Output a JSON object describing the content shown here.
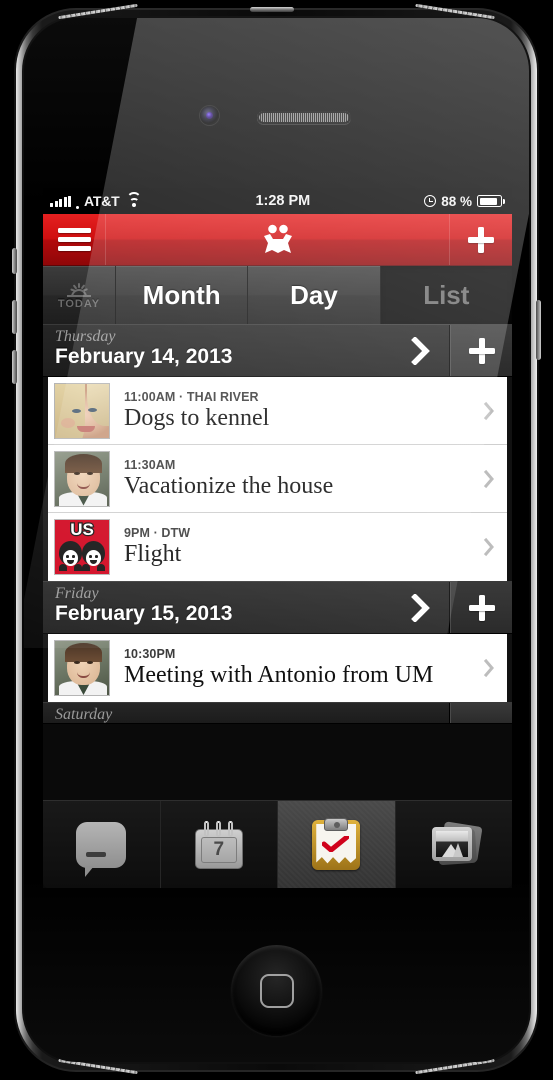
{
  "status_bar": {
    "signal_icon": "signal-bars-icon",
    "carrier": "AT&T",
    "wifi_icon": "wifi-icon",
    "time": "1:28 PM",
    "alarm_icon": "clock-icon",
    "battery_percent": "88 %",
    "battery_icon": "battery-icon"
  },
  "nav_bar": {
    "menu_icon": "hamburger-menu-icon",
    "logo_icon": "cozi-family-logo-icon",
    "add_icon": "plus-icon",
    "accent_color": "#cf0f10"
  },
  "tabs": [
    {
      "label": "TODAY",
      "icon": "sunrise-icon",
      "selected": false
    },
    {
      "label": "Month",
      "icon": "",
      "selected": false
    },
    {
      "label": "Day",
      "icon": "",
      "selected": false
    },
    {
      "label": "List",
      "icon": "",
      "selected": true
    }
  ],
  "agenda": {
    "days": [
      {
        "weekday": "Thursday",
        "date": "February 14, 2013",
        "chevron_icon": "chevron-right-icon",
        "add_icon": "plus-icon",
        "events": [
          {
            "meta": "11:00AM · THAI RIVER",
            "title": "Dogs to kennel",
            "avatar": "photo-woman",
            "chevron_icon": "chevron-right-icon"
          },
          {
            "meta": "11:30AM",
            "title": "Vacationize the house",
            "avatar": "photo-man",
            "chevron_icon": "chevron-right-icon"
          },
          {
            "meta": "9PM · DTW",
            "title": "Flight",
            "avatar": "us-family-badge",
            "avatar_label": "US",
            "chevron_icon": "chevron-right-icon"
          }
        ]
      },
      {
        "weekday": "Friday",
        "date": "February 15, 2013",
        "chevron_icon": "chevron-right-icon",
        "add_icon": "plus-icon",
        "events": [
          {
            "meta": "10:30PM",
            "title": "Meeting with Antonio from UM",
            "avatar": "photo-man",
            "chevron_icon": "chevron-right-icon"
          }
        ]
      },
      {
        "weekday": "Saturday",
        "date": "",
        "chevron_icon": "chevron-right-icon",
        "add_icon": "plus-icon",
        "events": []
      }
    ]
  },
  "toolbar": {
    "items": [
      {
        "name": "messages",
        "icon": "message-bubble-icon",
        "selected": false
      },
      {
        "name": "calendar",
        "icon": "calendar-icon",
        "badge": "7",
        "selected": false
      },
      {
        "name": "lists",
        "icon": "clipboard-check-icon",
        "selected": true
      },
      {
        "name": "photos",
        "icon": "photos-icon",
        "selected": false
      }
    ]
  },
  "device": {
    "home_button_icon": "home-button-icon",
    "camera_icon": "front-camera-icon",
    "speaker_icon": "earpiece-speaker-icon"
  }
}
